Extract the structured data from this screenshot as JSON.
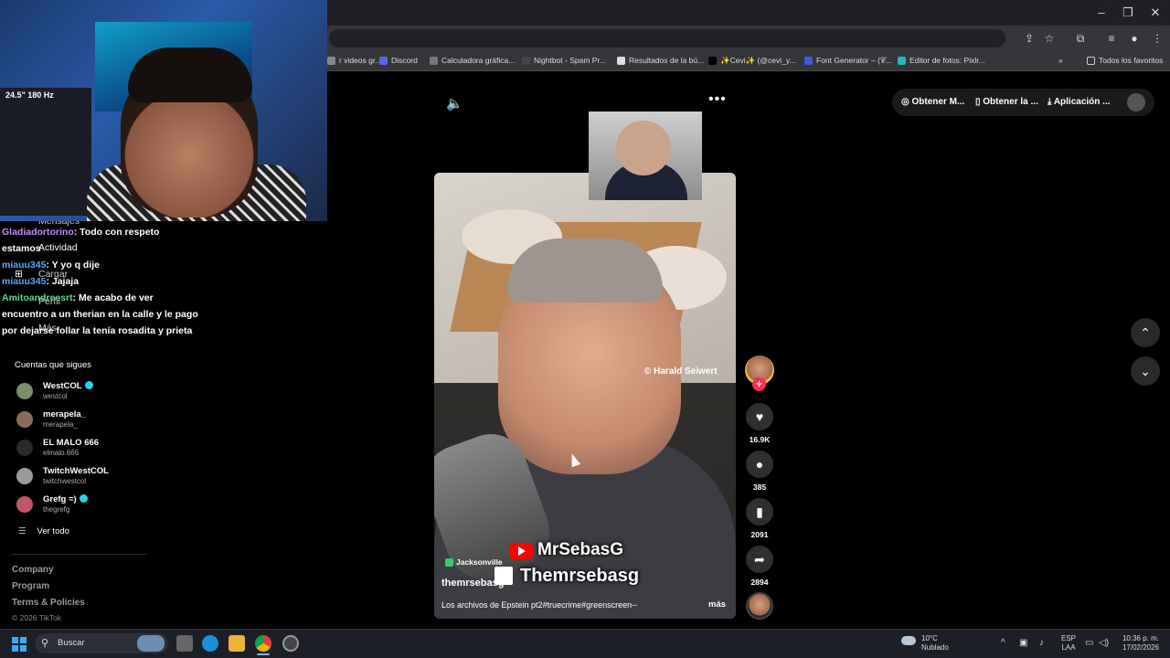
{
  "browser": {
    "window_controls": [
      "–",
      "❐",
      "✕"
    ],
    "bookmarks": [
      {
        "label": "r videos gr...",
        "color": "#888888"
      },
      {
        "label": "Discord",
        "color": "#5865F2"
      },
      {
        "label": "Calculadora gráfica...",
        "color": "#777777"
      },
      {
        "label": "Nightbot - Spam Pr...",
        "color": "#444444"
      },
      {
        "label": "Resultados de la bú...",
        "color": "#dddddd"
      },
      {
        "label": "✨Cevi✨ (@cevi_y...",
        "color": "#000000"
      },
      {
        "label": "Font Generator – (𝒞...",
        "color": "#3b5bdb"
      },
      {
        "label": "Editor de fotos: Pixlr...",
        "color": "#2bb3c0"
      }
    ],
    "bookmarks_overflow": "»",
    "all_bookmarks": "Todos los favoritos"
  },
  "webcam": {
    "monitor_badge": "24.5\" 180 Hz"
  },
  "chat": [
    {
      "user": "Gladiadortorino",
      "color": "#c48cff",
      "text": ": Todo con respeto estamos"
    },
    {
      "user": "miauu345",
      "color": "#5aa3ff",
      "text": ": Y yo q dije"
    },
    {
      "user": "miauu345",
      "color": "#5aa3ff",
      "text": ": Jajaja"
    },
    {
      "user": "Amitoandreesrt",
      "color": "#5fd68a",
      "text": ": Me acabo de ver encuentro a un therian en la calle y le pago por dejarse follar la tenía rosadita y prieta"
    }
  ],
  "sidebar_ghost": {
    "mensajes": "Mensajes",
    "actividad": "Actividad",
    "cargar": "Cargar",
    "perfil": "Perfil",
    "mas": "Más"
  },
  "following": {
    "title": "Cuentas que sigues",
    "accounts": [
      {
        "name": "WestCOL",
        "handle": "westcol",
        "verified": true,
        "avatar_color": "#7a8f6b"
      },
      {
        "name": "merapela_",
        "handle": "merapela_",
        "verified": false,
        "avatar_color": "#8a6a5a"
      },
      {
        "name": "EL MALO 666",
        "handle": "elmalo.666",
        "verified": false,
        "avatar_color": "#2a2a2a"
      },
      {
        "name": "TwitchWestCOL",
        "handle": "twitchwestcol",
        "verified": false,
        "avatar_color": "#9a9a9a"
      },
      {
        "name": "Grefg =)",
        "handle": "thegrefg",
        "verified": true,
        "avatar_color": "#c0586a"
      }
    ],
    "see_all": "Ver todo"
  },
  "footer": {
    "links": [
      "Company",
      "Program",
      "Terms & Policies"
    ],
    "copyright": "© 2026 TikTok"
  },
  "video": {
    "credit": "© Harald Seiwert",
    "brand_youtube": "MrSebasG",
    "brand_twitch": "Themrsebasg",
    "location": "Jacksonville",
    "author": "themrsebasg",
    "description": "Los archivos de Epstein pt2#truecrime#greenscreen--",
    "more": "más"
  },
  "actions": {
    "likes": "16.9K",
    "comments": "385",
    "saves": "2091",
    "shares": "2894"
  },
  "top_right": {
    "get_coins": "Obtener M...",
    "get_app": "Obtener la ...",
    "app": "Aplicación ..."
  },
  "taskbar": {
    "search_placeholder": "Buscar",
    "weather_temp": "10°C",
    "weather_desc": "Nublado",
    "lang1": "ESP",
    "lang2": "LAA",
    "time": "10:36 p. m.",
    "date": "17/02/2026"
  }
}
